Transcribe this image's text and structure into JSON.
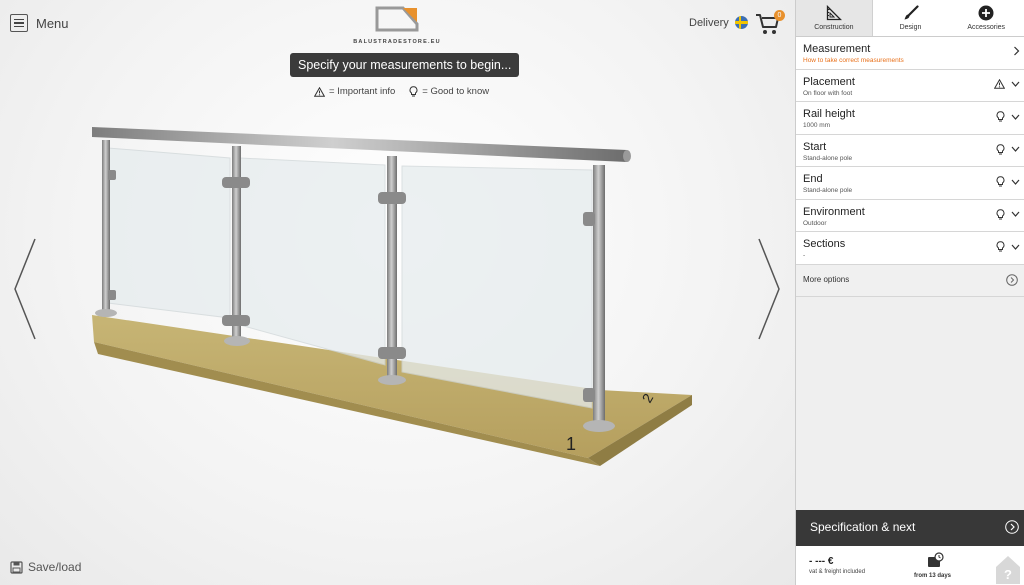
{
  "header": {
    "menu_label": "Menu",
    "logo_text": "BALUSTRADESTORE.EU",
    "delivery_label": "Delivery",
    "cart_count": "0"
  },
  "viewport": {
    "instruction": "Specify your measurements to begin...",
    "legend_important": "= Important info",
    "legend_good": "= Good to know",
    "save_load": "Save/load",
    "scene_labels": [
      "1",
      "2"
    ]
  },
  "tabs": [
    {
      "label": "Construction",
      "icon": "ruler-triangle-icon",
      "active": true
    },
    {
      "label": "Design",
      "icon": "brush-icon",
      "active": false
    },
    {
      "label": "Accessories",
      "icon": "plus-circle-icon",
      "active": false
    }
  ],
  "menu_items": [
    {
      "title": "Measurement",
      "subtitle": "How to take correct measurements",
      "subtitle_style": "link",
      "icons": [
        "chevron-right-icon"
      ]
    },
    {
      "title": "Placement",
      "subtitle": "On floor with foot",
      "icons": [
        "warning-icon",
        "chevron-down-icon"
      ]
    },
    {
      "title": "Rail height",
      "subtitle": "1000 mm",
      "icons": [
        "lightbulb-icon",
        "chevron-down-icon"
      ]
    },
    {
      "title": "Start",
      "subtitle": "Stand-alone pole",
      "icons": [
        "lightbulb-icon",
        "chevron-down-icon"
      ]
    },
    {
      "title": "End",
      "subtitle": "Stand-alone pole",
      "icons": [
        "lightbulb-icon",
        "chevron-down-icon"
      ]
    },
    {
      "title": "Environment",
      "subtitle": "Outdoor",
      "icons": [
        "lightbulb-icon",
        "chevron-down-icon"
      ]
    },
    {
      "title": "Sections",
      "subtitle": "-",
      "icons": [
        "lightbulb-icon",
        "chevron-down-icon"
      ]
    }
  ],
  "more_options": "More options",
  "footer": {
    "spec_label": "Specification & next",
    "price": "- --- €",
    "price_note": "vat & freight included",
    "lead_time": "from 13 days"
  },
  "colors": {
    "accent_orange": "#e8701a",
    "dark_bar": "#383838",
    "wood": "#b8a465"
  }
}
